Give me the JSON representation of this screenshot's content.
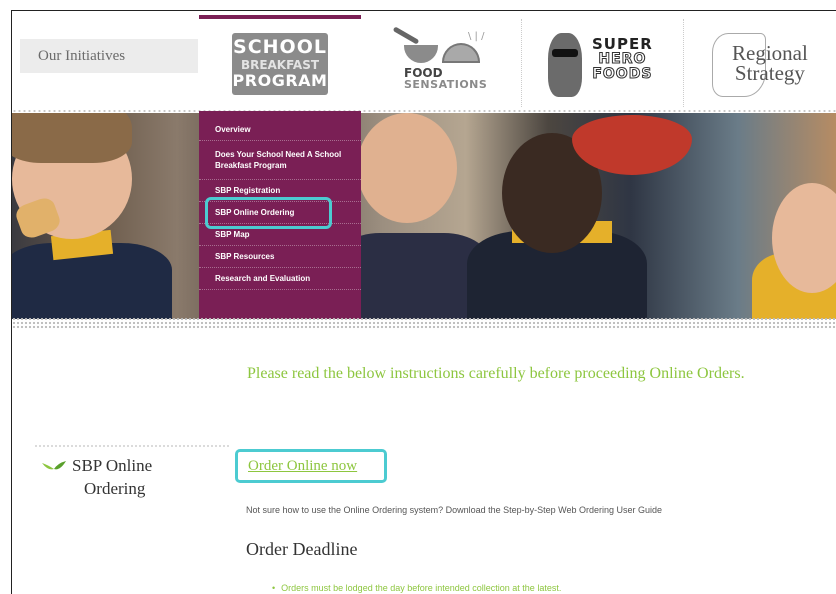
{
  "header": {
    "initiatives_label": "Our Initiatives",
    "logos": {
      "sbp": {
        "line1": "SCHOOL",
        "line2": "BREAKFAST",
        "line3": "PROGRAM"
      },
      "food_sensations": {
        "line1": "FOOD",
        "line2": "SENSATIONS"
      },
      "super_hero_foods": {
        "line1": "SUPER",
        "line2": "HERO",
        "line3": "FOODS"
      },
      "regional_strategy": {
        "line1": "Regional",
        "line2": "Strategy"
      }
    }
  },
  "menu": {
    "items": [
      {
        "label": "Overview"
      },
      {
        "label": "Does Your School Need A School Breakfast Program"
      },
      {
        "label": "SBP Registration"
      },
      {
        "label": "SBP Online Ordering"
      },
      {
        "label": "SBP Map"
      },
      {
        "label": "SBP Resources"
      },
      {
        "label": "Research and Evaluation"
      }
    ],
    "highlight_color": "#4ccbd1",
    "bg_color": "#7a1f55"
  },
  "sidebar": {
    "title_line1": "SBP Online",
    "title_line2": "Ordering",
    "icon": "leaf-icon"
  },
  "content": {
    "intro": "Please read the below instructions carefully before proceeding Online Orders.",
    "order_link": "Order Online now",
    "help_text": "Not sure how to use the Online Ordering system? Download the Step-by-Step Web Ordering User Guide",
    "deadline_title": "Order Deadline",
    "bullets": [
      "Orders must be lodged the day before intended collection at the latest."
    ]
  },
  "colors": {
    "accent_green": "#8dc63f",
    "highlight_teal": "#4ccbd1",
    "brand_purple": "#7a1f55"
  }
}
